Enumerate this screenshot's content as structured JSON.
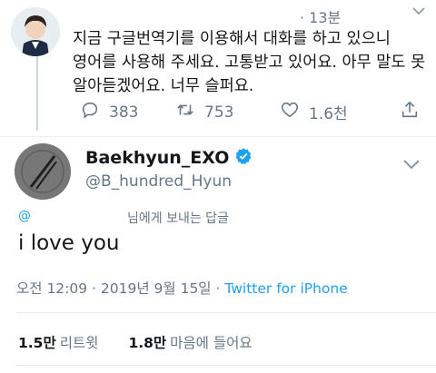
{
  "parent_tweet": {
    "time": "· 13분",
    "text_lines": [
      "지금 구글번역기를 이용해서 대화를 하고 있으니",
      "영어를 사용해 주세요. 고통받고 있어요. 아무 말도 못",
      "알아듣겠어요. 너무 슬퍼요."
    ],
    "replies": "383",
    "retweets": "753",
    "likes": "1.6천"
  },
  "main_tweet": {
    "display_name": "Baekhyun_EXO",
    "handle": "@B_hundred_Hyun",
    "reply_to_at": "@",
    "reply_to_label": "님에게 보내는 답글",
    "text": "i love you",
    "timestamp": "오전 12:09 · 2019년 9월 15일 · ",
    "source": "Twitter for iPhone",
    "retweet_count": "1.5만",
    "retweet_label": "리트윗",
    "like_count": "1.8만",
    "like_label": "마음에 들어요"
  },
  "icons": {
    "reply": "reply-icon",
    "retweet": "retweet-icon",
    "like": "heart-icon",
    "share": "share-icon",
    "verified": "verified-badge-icon",
    "menu": "chevron-down-icon"
  },
  "colors": {
    "accent": "#1da1f2",
    "muted": "#657786",
    "text": "#14171a"
  }
}
